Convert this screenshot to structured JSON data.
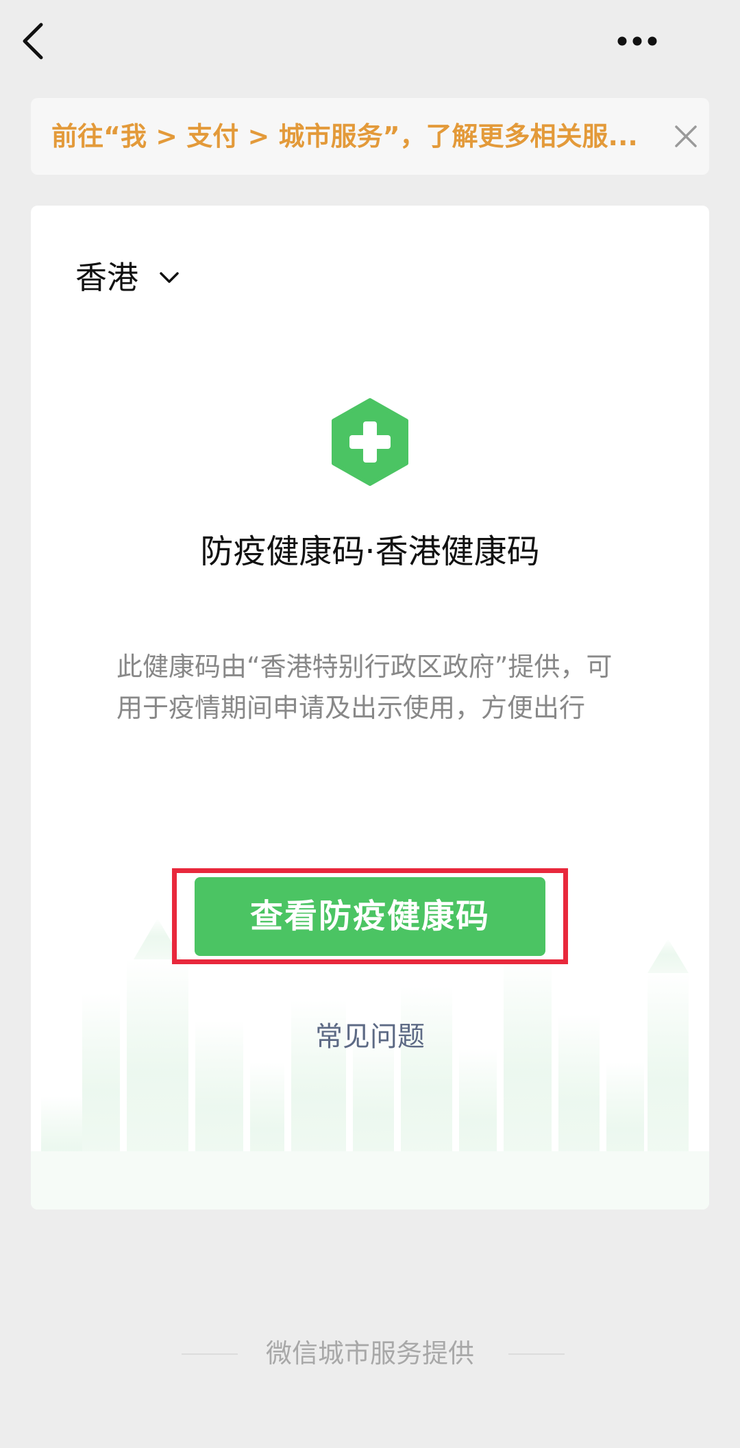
{
  "nav": {
    "back_icon": "chevron-left-icon",
    "more_icon": "more-dots-icon"
  },
  "notice": {
    "text": "前往“我 > 支付 > 城市服务”，了解更多相关服...",
    "close_icon": "close-icon",
    "color": "#e39a3a"
  },
  "region": {
    "selected": "香港",
    "icon": "chevron-down-icon"
  },
  "service": {
    "icon": "medical-cross-icon",
    "title": "防疫健康码·香港健康码",
    "description": "此健康码由“香港特别行政区政府”提供，可用于疫情期间申请及出示使用，方便出行"
  },
  "actions": {
    "primary_label": "查看防疫健康码",
    "faq_label": "常见问题"
  },
  "footer": {
    "text": "微信城市服务提供"
  },
  "colors": {
    "accent_green": "#4bc463",
    "highlight_red": "#e8283c",
    "background": "#ededed"
  }
}
